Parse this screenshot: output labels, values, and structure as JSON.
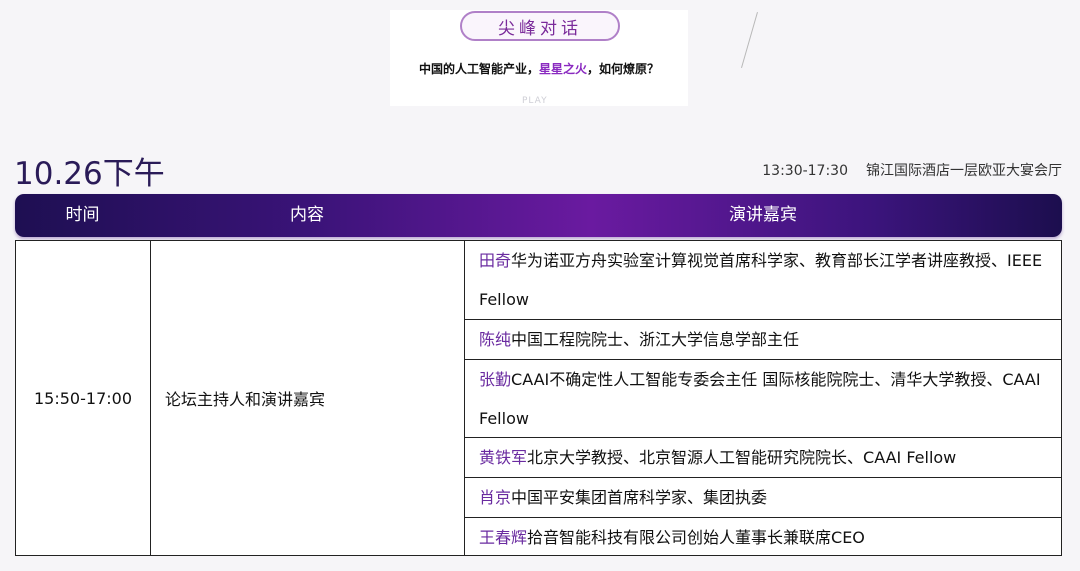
{
  "banner": {
    "pill_text": "尖峰对话",
    "headline_pre": "中国的人工智能产业，",
    "headline_hl": "星星之火",
    "headline_post": "，如何燎原？",
    "faint_text": "PLAY"
  },
  "session": {
    "date": "10.26下午",
    "time_range": "13:30-17:30",
    "venue": "锦江国际酒店一层欧亚大宴会厅"
  },
  "table": {
    "headers": {
      "time": "时间",
      "content": "内容",
      "speakers": "演讲嘉宾"
    },
    "time": "15:50-17:00",
    "content": "论坛主持人和演讲嘉宾",
    "speakers": [
      {
        "name": "田奇",
        "title": "华为诺亚方舟实验室计算视觉首席科学家、教育部长江学者讲座教授、IEEE Fellow"
      },
      {
        "name": "陈纯",
        "title": "中国工程院院士、浙江大学信息学部主任"
      },
      {
        "name": "张勤",
        "title": "CAAI不确定性人工智能专委会主任 国际核能院院士、清华大学教授、CAAI Fellow"
      },
      {
        "name": "黄铁军",
        "title": "北京大学教授、北京智源人工智能研究院院长、CAAI Fellow"
      },
      {
        "name": "肖京",
        "title": "中国平安集团首席科学家、集团执委"
      },
      {
        "name": "王春辉",
        "title": "拾音智能科技有限公司创始人董事长兼联席CEO"
      }
    ]
  },
  "colors": {
    "header_gradient": [
      "#1e0f52",
      "#6a1aa0"
    ],
    "speaker_name": "#6a2ba0",
    "highlight": "#8a2ac0"
  }
}
